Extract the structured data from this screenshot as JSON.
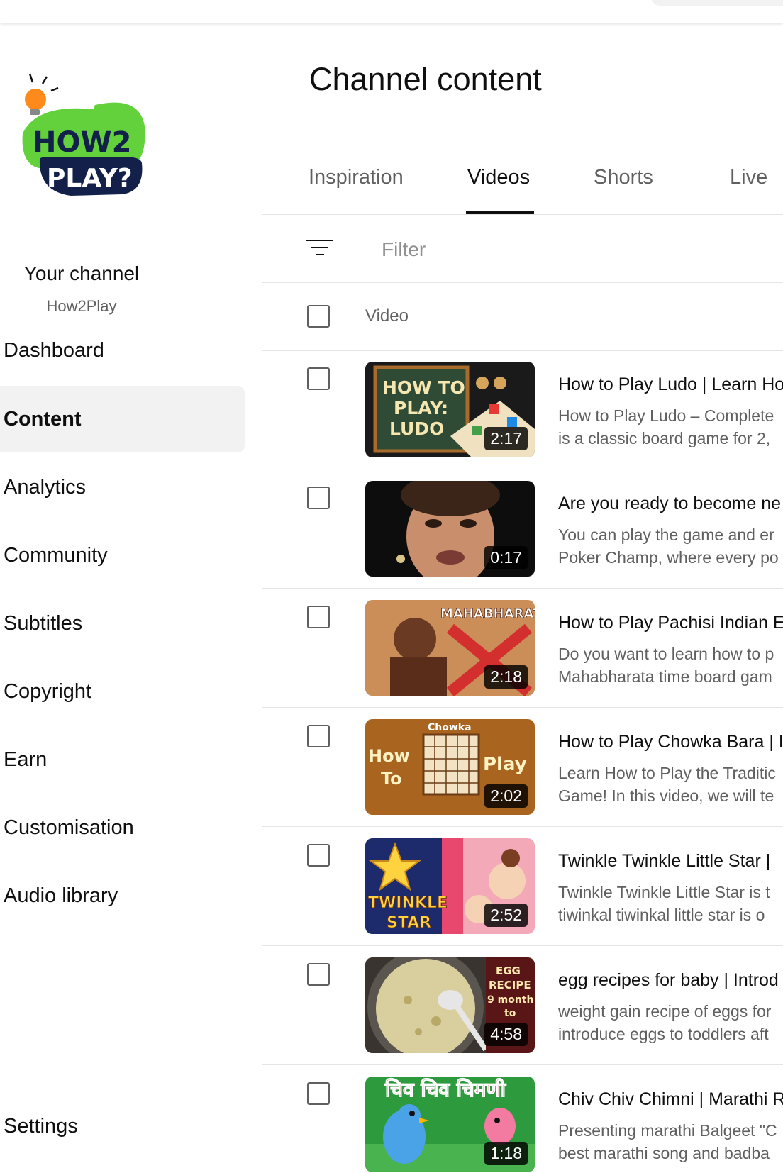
{
  "sidebar": {
    "logo": {
      "line1": "HOW2",
      "line2": "PLAY?"
    },
    "your_channel_label": "Your channel",
    "channel_name": "How2Play",
    "items": [
      {
        "label": "Dashboard"
      },
      {
        "label": "Content"
      },
      {
        "label": "Analytics"
      },
      {
        "label": "Community"
      },
      {
        "label": "Subtitles"
      },
      {
        "label": "Copyright"
      },
      {
        "label": "Earn"
      },
      {
        "label": "Customisation"
      },
      {
        "label": "Audio library"
      },
      {
        "label": "Settings"
      }
    ],
    "active_item": "Content"
  },
  "main": {
    "title": "Channel content",
    "tabs": [
      {
        "label": "Inspiration"
      },
      {
        "label": "Videos"
      },
      {
        "label": "Shorts"
      },
      {
        "label": "Live"
      }
    ],
    "active_tab": "Videos",
    "filter": {
      "placeholder": "Filter"
    },
    "table_header": {
      "video": "Video"
    },
    "videos": [
      {
        "title": "How to Play Ludo | Learn Ho",
        "desc1": "How to Play Ludo – Complete",
        "desc2": "is a classic board game for 2,",
        "duration": "2:17",
        "thumb_text": "HOW TO PLAY: LUDO"
      },
      {
        "title": "Are you ready to become ne",
        "desc1": "You can play the game and er",
        "desc2": "Poker Champ, where every po",
        "duration": "0:17",
        "thumb_text": ""
      },
      {
        "title": "How to Play Pachisi Indian E",
        "desc1": "Do you want to learn how to p",
        "desc2": "Mahabharata time board gam",
        "duration": "2:18",
        "thumb_text": "MAHABHARAT"
      },
      {
        "title": "How to Play Chowka Bara | I",
        "desc1": "Learn How to Play the Traditic",
        "desc2": "Game! In this video, we will te",
        "duration": "2:02",
        "thumb_text": "How To Play"
      },
      {
        "title": "Twinkle Twinkle Little Star |",
        "desc1": "Twinkle Twinkle Little Star is t",
        "desc2": "tiwinkal tiwinkal little star is o",
        "duration": "2:52",
        "thumb_text": "TWINKLE STAR"
      },
      {
        "title": "egg recipes for baby | Introd",
        "desc1": "weight gain recipe of eggs for",
        "desc2": "introduce eggs to toddlers aft",
        "duration": "4:58",
        "thumb_text": "EGG RECIPE 9 month to"
      },
      {
        "title": "Chiv Chiv Chimni | Marathi R",
        "desc1": "Presenting marathi Balgeet \"C",
        "desc2": "best marathi song and badba",
        "duration": "1:18",
        "thumb_text": "चिव चिव चिमणी"
      }
    ]
  }
}
